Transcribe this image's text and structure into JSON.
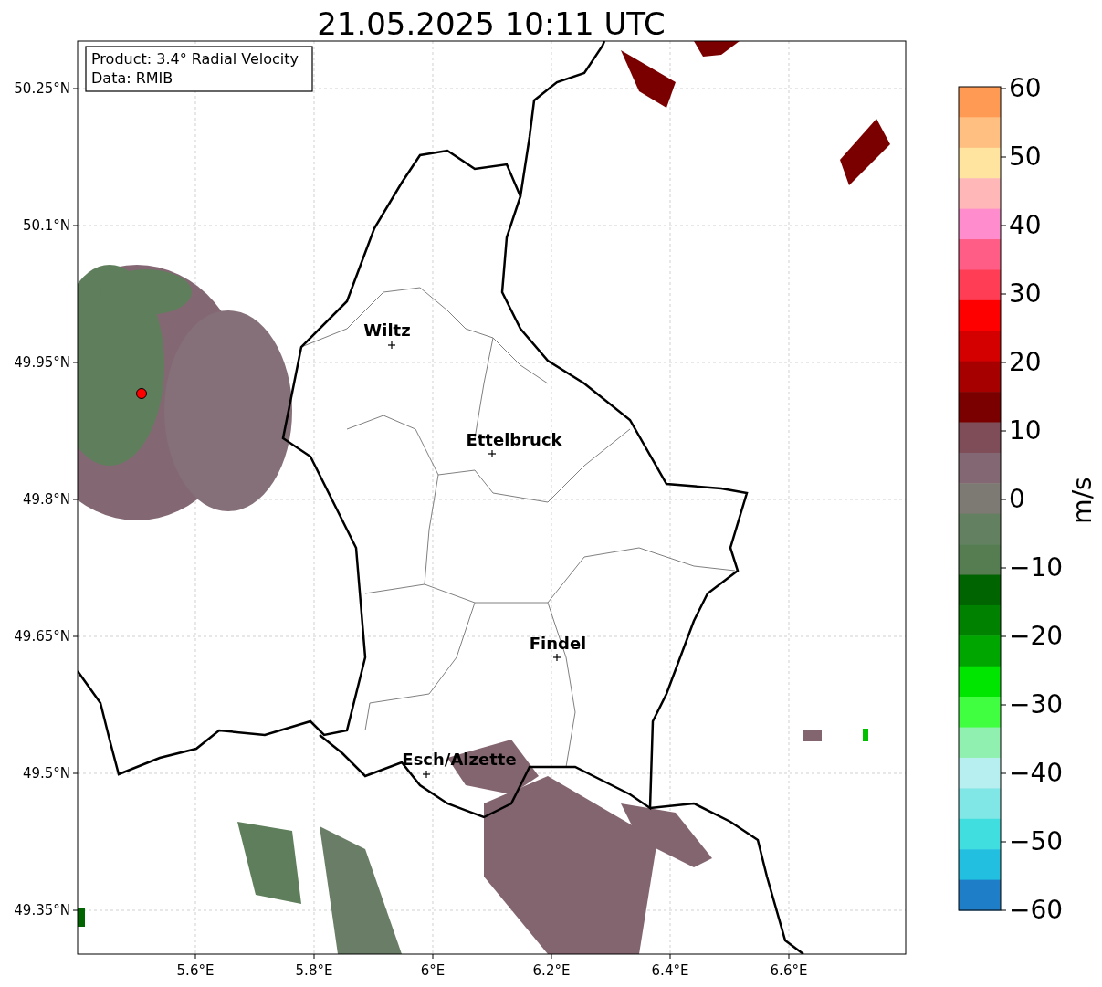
{
  "title": "21.05.2025 10:11 UTC",
  "info_box": [
    "Product: 3.4° Radial Velocity",
    "Data: RMIB"
  ],
  "y_ticks": [
    "50.25°N",
    "50.1°N",
    "49.95°N",
    "49.8°N",
    "49.65°N",
    "49.5°N",
    "49.35°N"
  ],
  "x_ticks": [
    "5.6°E",
    "5.8°E",
    "6°E",
    "6.2°E",
    "6.4°E",
    "6.6°E"
  ],
  "places": [
    {
      "name": "Wiltz"
    },
    {
      "name": "Ettelbruck"
    },
    {
      "name": "Findel"
    },
    {
      "name": "Esch/Alzette"
    }
  ],
  "colorbar": {
    "label": "m/s",
    "ticks": [
      "60",
      "50",
      "40",
      "30",
      "20",
      "10",
      "0",
      "−10",
      "−20",
      "−30",
      "−40",
      "−50",
      "−60"
    ]
  }
}
